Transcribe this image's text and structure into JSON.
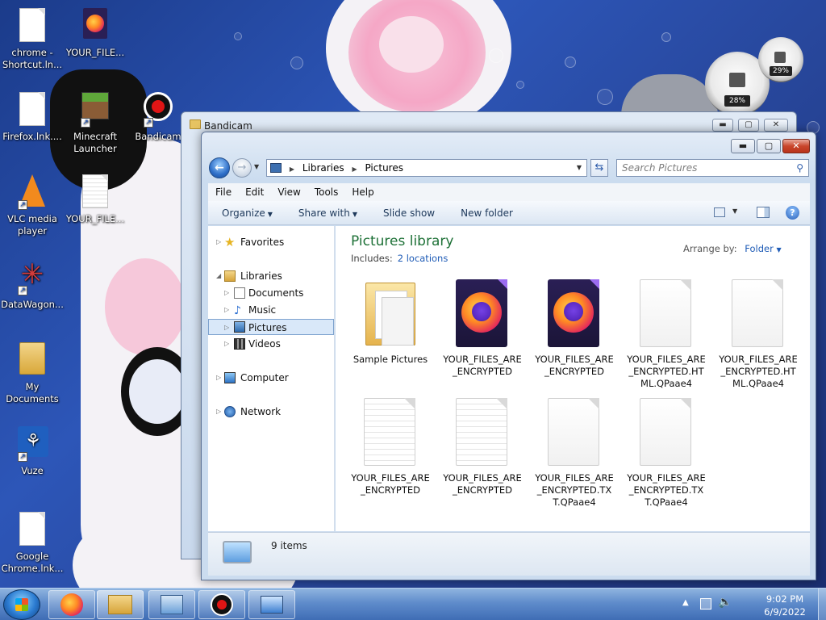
{
  "desktop": {
    "icons": [
      {
        "label": "chrome - Shortcut.ln..."
      },
      {
        "label": "YOUR_FILE..."
      },
      {
        "label": "Firefox.lnk...."
      },
      {
        "label": "Minecraft Launcher"
      },
      {
        "label": "Bandicam"
      },
      {
        "label": "VLC media player"
      },
      {
        "label": "YOUR_FILE..."
      },
      {
        "label": "DataWagon..."
      },
      {
        "label": "My Documents"
      },
      {
        "label": "Vuze"
      },
      {
        "label": "Google Chrome.lnk..."
      }
    ]
  },
  "gadget": {
    "cpu_percent": "28%",
    "mem_percent": "29%"
  },
  "back_window": {
    "title": "Bandicam"
  },
  "explorer": {
    "address": {
      "crumb1": "Libraries",
      "crumb2": "Pictures"
    },
    "search_placeholder": "Search Pictures",
    "menu": [
      "File",
      "Edit",
      "View",
      "Tools",
      "Help"
    ],
    "toolbar": {
      "organize": "Organize",
      "share_with": "Share with",
      "slide_show": "Slide show",
      "new_folder": "New folder"
    },
    "nav": {
      "favorites": "Favorites",
      "libraries": "Libraries",
      "documents": "Documents",
      "music": "Music",
      "pictures": "Pictures",
      "videos": "Videos",
      "computer": "Computer",
      "network": "Network"
    },
    "library": {
      "title": "Pictures library",
      "includes_label": "Includes:",
      "locations_link": "2 locations",
      "arrange_label": "Arrange by:",
      "arrange_value": "Folder"
    },
    "files": [
      {
        "name": "Sample Pictures",
        "type": "folder"
      },
      {
        "name": "YOUR_FILES_ARE_ENCRYPTED",
        "type": "firefox"
      },
      {
        "name": "YOUR_FILES_ARE_ENCRYPTED",
        "type": "firefox"
      },
      {
        "name": "YOUR_FILES_ARE_ENCRYPTED.HTML.QPaae4",
        "type": "blank"
      },
      {
        "name": "YOUR_FILES_ARE_ENCRYPTED.HTML.QPaae4",
        "type": "blank"
      },
      {
        "name": "YOUR_FILES_ARE_ENCRYPTED",
        "type": "text"
      },
      {
        "name": "YOUR_FILES_ARE_ENCRYPTED",
        "type": "text"
      },
      {
        "name": "YOUR_FILES_ARE_ENCRYPTED.TXT.QPaae4",
        "type": "blank"
      },
      {
        "name": "YOUR_FILES_ARE_ENCRYPTED.TXT.QPaae4",
        "type": "blank"
      }
    ],
    "status": {
      "item_count": "9 items"
    }
  },
  "taskbar": {
    "clock_time": "9:02 PM",
    "clock_date": "6/9/2022"
  }
}
